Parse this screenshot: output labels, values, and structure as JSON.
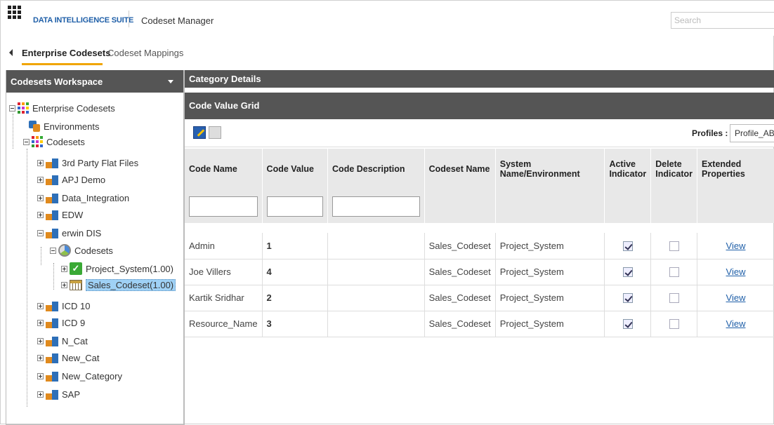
{
  "header": {
    "brand": "DATA INTELLIGENCE SUITE",
    "app_title": "Codeset Manager",
    "search_placeholder": "Search"
  },
  "tabs": [
    {
      "label": "Enterprise Codesets",
      "active": true
    },
    {
      "label": "Codeset Mappings",
      "active": false
    }
  ],
  "workspace": {
    "title": "Codesets Workspace",
    "tree": {
      "root": "Enterprise Codesets",
      "environments": "Environments",
      "codesets": "Codesets",
      "categories": [
        "3rd Party Flat Files",
        "APJ Demo",
        "Data_Integration",
        "EDW",
        "erwin DIS"
      ],
      "erwin_dis_codesets": "Codesets",
      "project_system": "Project_System(1.00)",
      "sales_codeset": "Sales_Codeset(1.00)",
      "more_categories": [
        "ICD 10",
        "ICD 9",
        "N_Cat",
        "New_Cat",
        "New_Category",
        "SAP"
      ]
    }
  },
  "details": {
    "category_title": "Category Details",
    "grid_title": "Code Value Grid",
    "profiles_label": "Profiles :",
    "profiles_value": "Profile_ABC"
  },
  "grid": {
    "columns": [
      "Code Name",
      "Code Value",
      "Code Description",
      "Codeset Name",
      "System Name/Environment",
      "Active Indicator",
      "Delete Indicator",
      "Extended Properties"
    ],
    "rows": [
      {
        "code_name": "Admin",
        "code_value": "1",
        "code_description": "",
        "codeset_name": "Sales_Codeset",
        "system": "Project_System",
        "active": true,
        "delete": false,
        "ext": "View"
      },
      {
        "code_name": "Joe Villers",
        "code_value": "4",
        "code_description": "",
        "codeset_name": "Sales_Codeset",
        "system": "Project_System",
        "active": true,
        "delete": false,
        "ext": "View"
      },
      {
        "code_name": "Kartik Sridhar",
        "code_value": "2",
        "code_description": "",
        "codeset_name": "Sales_Codeset",
        "system": "Project_System",
        "active": true,
        "delete": false,
        "ext": "View"
      },
      {
        "code_name": "Resource_Name",
        "code_value": "3",
        "code_description": "",
        "codeset_name": "Sales_Codeset",
        "system": "Project_System",
        "active": true,
        "delete": false,
        "ext": "View"
      }
    ]
  },
  "colors": {
    "brand_blue": "#1f5fa8",
    "tab_underline": "#f0a500",
    "panel_header": "#555555",
    "selected_node": "#9fd1f5"
  }
}
